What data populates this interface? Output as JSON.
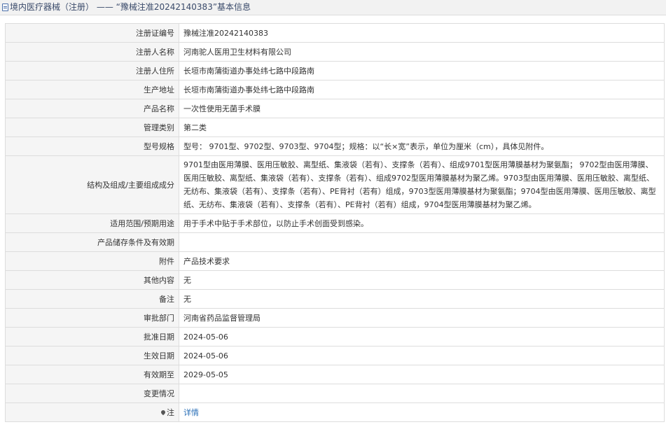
{
  "header": {
    "title": "境内医疗器械（注册） ——  “豫械注准20242140383”基本信息"
  },
  "rows": [
    {
      "label": "注册证编号",
      "value": "豫械注准20242140383"
    },
    {
      "label": "注册人名称",
      "value": "河南驼人医用卫生材料有限公司"
    },
    {
      "label": "注册人住所",
      "value": "长垣市南蒲街道办事处纬七路中段路南"
    },
    {
      "label": "生产地址",
      "value": "长垣市南蒲街道办事处纬七路中段路南"
    },
    {
      "label": "产品名称",
      "value": "一次性使用无菌手术膜"
    },
    {
      "label": "管理类别",
      "value": "第二类"
    },
    {
      "label": "型号规格",
      "value": "型号： 9701型、9702型、9703型、9704型；规格：以“长×宽”表示，单位为厘米（cm），具体见附件。"
    },
    {
      "label": "结构及组成/主要组成成分",
      "value": "9701型由医用薄膜、医用压敏胶、离型纸、集液袋（若有）、支撑条（若有）、组成9701型医用薄膜基材为聚氨酯； 9702型由医用薄膜、医用压敏胶、离型纸、集液袋（若有）、支撑条（若有）、组成9702型医用薄膜基材为聚乙烯。9703型由医用薄膜、医用压敏胶、离型纸、无纺布、集液袋（若有）、支撑条（若有）、PE背衬（若有）组成，9703型医用薄膜基材为聚氨酯；9704型由医用薄膜、医用压敏胶、离型纸、无纺布、集液袋（若有）、支撑条（若有）、PE背衬（若有）组成，9704型医用薄膜基材为聚乙烯。"
    },
    {
      "label": "适用范围/预期用途",
      "value": "用于手术中贴于手术部位，以防止手术创面受到感染。"
    },
    {
      "label": "产品储存条件及有效期",
      "value": ""
    },
    {
      "label": "附件",
      "value": "产品技术要求"
    },
    {
      "label": "其他内容",
      "value": "无"
    },
    {
      "label": "备注",
      "value": "无"
    },
    {
      "label": "审批部门",
      "value": "河南省药品监督管理局"
    },
    {
      "label": "批准日期",
      "value": "2024-05-06"
    },
    {
      "label": "生效日期",
      "value": "2024-05-06"
    },
    {
      "label": "有效期至",
      "value": "2029-05-05"
    },
    {
      "label": "变更情况",
      "value": ""
    }
  ],
  "note_row": {
    "label": "注",
    "link_text": "详情",
    "icon": "pin-icon"
  }
}
